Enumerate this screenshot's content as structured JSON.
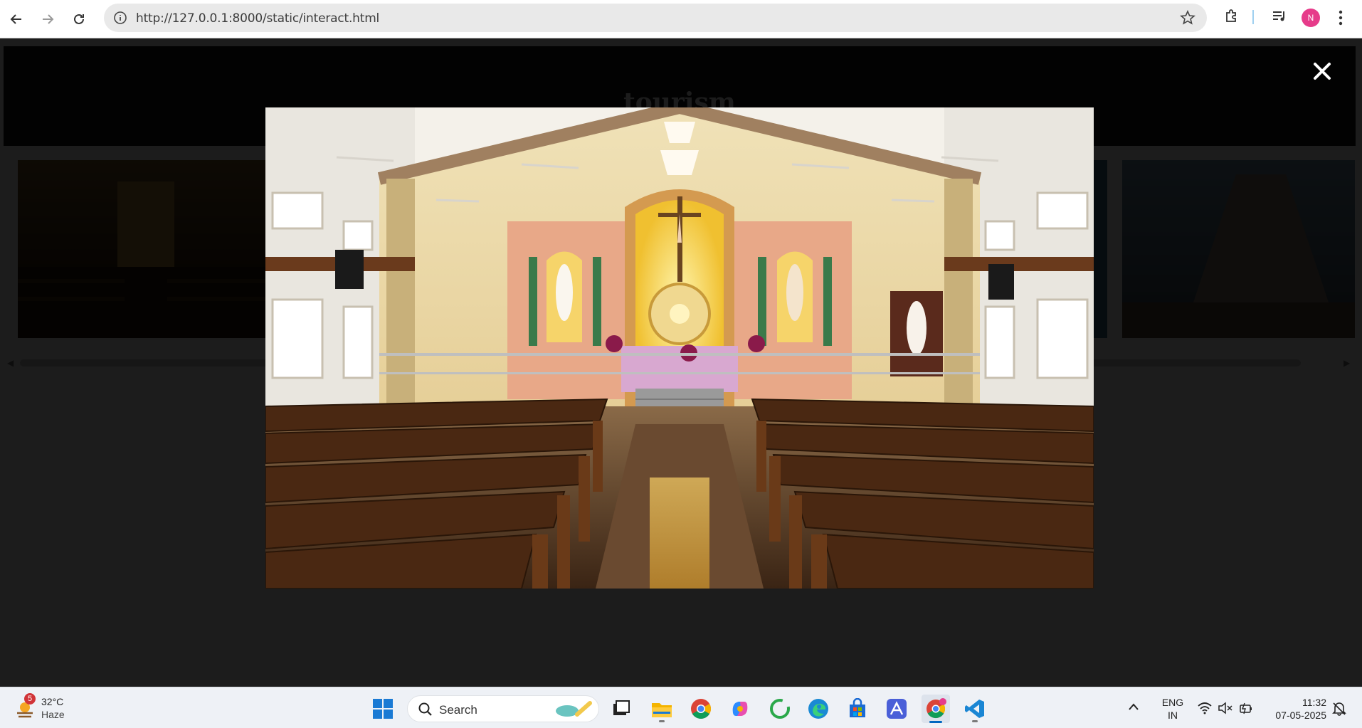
{
  "browser": {
    "url": "http://127.0.0.1:8000/static/interact.html",
    "avatar_letter": "N"
  },
  "page": {
    "title": "tourism"
  },
  "modal": {
    "image_alt": "Church interior with altar, pews and crucifix",
    "close_symbol": "✕"
  },
  "taskbar": {
    "weather": {
      "temperature": "32°C",
      "condition": "Haze",
      "badge": "5"
    },
    "search_label": "Search",
    "language": {
      "line1": "ENG",
      "line2": "IN"
    },
    "clock": {
      "time": "11:32",
      "date": "07-05-2025"
    },
    "apps": [
      "windows-start",
      "search",
      "copilot-widget",
      "task-view",
      "file-explorer",
      "chrome",
      "copilot",
      "greenshot",
      "edge",
      "microsoft-store",
      "app-a",
      "chrome-profile",
      "vscode"
    ]
  },
  "colors": {
    "accent": "#0067c0",
    "overlay": "#000000",
    "header": "#1a1a1a"
  }
}
